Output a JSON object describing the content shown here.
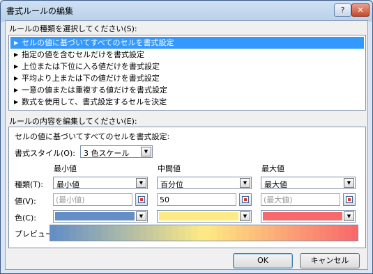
{
  "dialog": {
    "title": "書式ルールの編集",
    "help_label": "?",
    "close_label": "✕"
  },
  "rule_type": {
    "label": "ルールの種類を選択してください(S):",
    "items": [
      "セルの値に基づいてすべてのセルを書式設定",
      "指定の値を含むセルだけを書式設定",
      "上位または下位に入る値だけを書式設定",
      "平均より上または下の値だけを書式設定",
      "一意の値または重複する値だけを書式設定",
      "数式を使用して、書式設定するセルを決定"
    ],
    "selected_index": 0
  },
  "rule_desc": {
    "label": "ルールの内容を編集してください(E):",
    "subheading": "セルの値に基づいてすべてのセルを書式設定:",
    "style_label": "書式スタイル(O):",
    "style_value": "3 色スケール",
    "columns": {
      "min": "最小値",
      "mid": "中間値",
      "max": "最大値"
    },
    "row_labels": {
      "type": "種類(T):",
      "value": "値(V):",
      "color": "色(C):"
    },
    "type_values": {
      "min": "最小値",
      "mid": "百分位",
      "max": "最大値"
    },
    "value_fields": {
      "min_placeholder": "(最小値)",
      "mid_value": "50",
      "max_placeholder": "(最大値)"
    },
    "colors": {
      "min": "#638ec6",
      "mid": "#ffeb84",
      "max": "#f8696b"
    },
    "preview_label": "プレビュー:"
  },
  "buttons": {
    "ok": "OK",
    "cancel": "キャンセル"
  }
}
